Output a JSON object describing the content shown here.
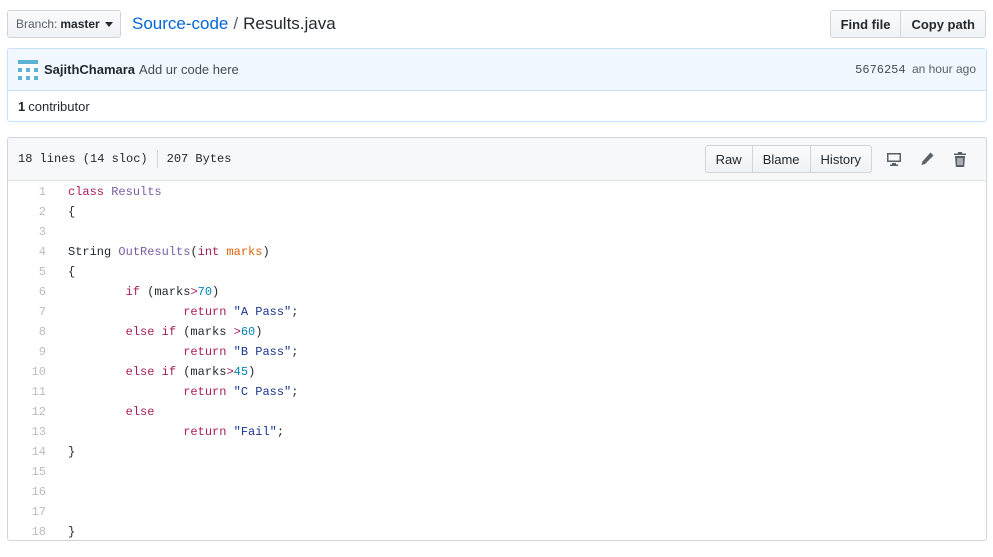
{
  "branch": {
    "prefix": "Branch:",
    "name": "master"
  },
  "breadcrumb": {
    "repo": "Source-code",
    "separator": "/",
    "file": "Results.java"
  },
  "file_nav": {
    "find_file": "Find file",
    "copy_path": "Copy path"
  },
  "commit": {
    "author": "SajithChamara",
    "message": "Add ur code here",
    "sha": "5676254",
    "time": "an hour ago"
  },
  "contributors": {
    "count": "1",
    "label": "contributor"
  },
  "file_info": {
    "lines": "18 lines (14 sloc)",
    "size": "207 Bytes"
  },
  "file_actions": {
    "raw": "Raw",
    "blame": "Blame",
    "history": "History"
  },
  "code_lines": [
    [
      {
        "t": "class",
        "c": "kw"
      },
      {
        "t": " "
      },
      {
        "t": "Results",
        "c": "en"
      }
    ],
    [
      {
        "t": "{"
      }
    ],
    [],
    [
      {
        "t": "String "
      },
      {
        "t": "OutResults",
        "c": "en"
      },
      {
        "t": "("
      },
      {
        "t": "int",
        "c": "kw"
      },
      {
        "t": " "
      },
      {
        "t": "marks",
        "c": "var"
      },
      {
        "t": ")"
      }
    ],
    [
      {
        "t": "{"
      }
    ],
    [
      {
        "t": "        "
      },
      {
        "t": "if",
        "c": "kw"
      },
      {
        "t": " (marks"
      },
      {
        "t": ">",
        "c": "kw"
      },
      {
        "t": "70",
        "c": "num"
      },
      {
        "t": ")"
      }
    ],
    [
      {
        "t": "                "
      },
      {
        "t": "return",
        "c": "kw"
      },
      {
        "t": " "
      },
      {
        "t": "\"A Pass\"",
        "c": "str"
      },
      {
        "t": ";"
      }
    ],
    [
      {
        "t": "        "
      },
      {
        "t": "else",
        "c": "kw"
      },
      {
        "t": " "
      },
      {
        "t": "if",
        "c": "kw"
      },
      {
        "t": " (marks "
      },
      {
        "t": ">",
        "c": "kw"
      },
      {
        "t": "60",
        "c": "num"
      },
      {
        "t": ")"
      }
    ],
    [
      {
        "t": "                "
      },
      {
        "t": "return",
        "c": "kw"
      },
      {
        "t": " "
      },
      {
        "t": "\"B Pass\"",
        "c": "str"
      },
      {
        "t": ";"
      }
    ],
    [
      {
        "t": "        "
      },
      {
        "t": "else",
        "c": "kw"
      },
      {
        "t": " "
      },
      {
        "t": "if",
        "c": "kw"
      },
      {
        "t": " (marks"
      },
      {
        "t": ">",
        "c": "kw"
      },
      {
        "t": "45",
        "c": "num"
      },
      {
        "t": ")"
      }
    ],
    [
      {
        "t": "                "
      },
      {
        "t": "return",
        "c": "kw"
      },
      {
        "t": " "
      },
      {
        "t": "\"C Pass\"",
        "c": "str"
      },
      {
        "t": ";"
      }
    ],
    [
      {
        "t": "        "
      },
      {
        "t": "else",
        "c": "kw"
      }
    ],
    [
      {
        "t": "                "
      },
      {
        "t": "return",
        "c": "kw"
      },
      {
        "t": " "
      },
      {
        "t": "\"Fail\"",
        "c": "str"
      },
      {
        "t": ";"
      }
    ],
    [
      {
        "t": "}"
      }
    ],
    [],
    [],
    [],
    [
      {
        "t": "}"
      }
    ]
  ],
  "icons": [
    "caret-down-icon",
    "avatar-identicon",
    "desktop-icon",
    "pencil-icon",
    "trashcan-icon"
  ]
}
